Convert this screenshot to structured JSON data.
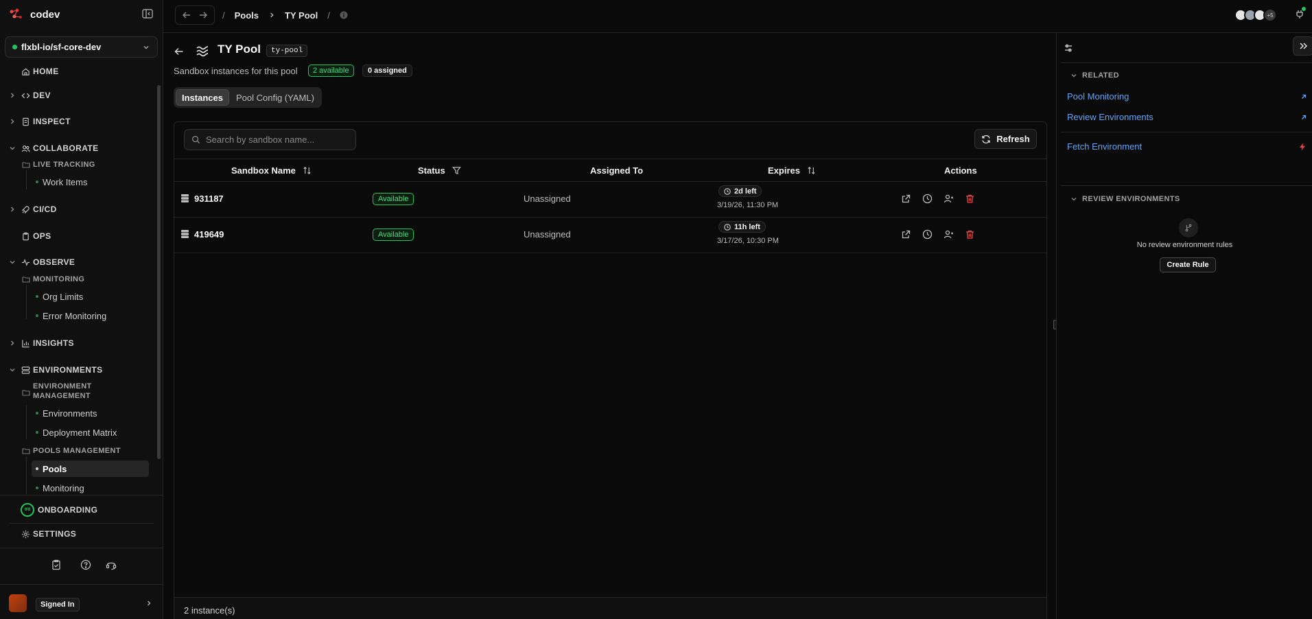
{
  "brand": {
    "name": "codev"
  },
  "workspace": {
    "name": "flxbl-io/sf-core-dev"
  },
  "sidebar": {
    "home": "HOME",
    "dev": "DEV",
    "inspect": "INSPECT",
    "collaborate": "COLLABORATE",
    "live_tracking": "LIVE TRACKING",
    "work_items": "Work Items",
    "cicd": "CI/CD",
    "ops": "OPS",
    "observe": "OBSERVE",
    "monitoring": "MONITORING",
    "org_limits": "Org Limits",
    "error_monitoring": "Error Monitoring",
    "insights": "INSIGHTS",
    "environments": "ENVIRONMENTS",
    "env_mgmt_1": "ENVIRONMENT",
    "env_mgmt_2": "MANAGEMENT",
    "environments_sub": "Environments",
    "deployment_matrix": "Deployment Matrix",
    "pools_mgmt": "POOLS MANAGEMENT",
    "pools": "Pools",
    "pools_monitoring": "Monitoring",
    "onboarding": "ONBOARDING",
    "onboarding_badge": "0/8",
    "settings": "SETTINGS"
  },
  "user": {
    "status": "Signed In"
  },
  "topbar": {
    "breadcrumbs": [
      "/",
      "Pools",
      "TY Pool",
      "/"
    ],
    "avatars_more": "+5"
  },
  "page": {
    "title": "TY Pool",
    "slug": "ty-pool",
    "subtitle": "Sandbox instances for this pool",
    "available_badge": "2 available",
    "assigned_badge": "0 assigned",
    "tabs": [
      {
        "label": "Instances",
        "active": true
      },
      {
        "label": "Pool Config (YAML)",
        "active": false
      }
    ]
  },
  "table": {
    "search_placeholder": "Search by sandbox name...",
    "refresh_label": "Refresh",
    "columns": [
      "Sandbox Name",
      "Status",
      "Assigned To",
      "Expires",
      "Actions"
    ],
    "rows": [
      {
        "name": "931187",
        "status": "Available",
        "assigned": "Unassigned",
        "time_left": "2d left",
        "expires": "3/19/26, 11:30 PM"
      },
      {
        "name": "419649",
        "status": "Available",
        "assigned": "Unassigned",
        "time_left": "11h left",
        "expires": "3/17/26, 10:30 PM"
      }
    ],
    "footer": "2 instance(s)"
  },
  "right_panel": {
    "related_title": "RELATED",
    "links": [
      "Pool Monitoring",
      "Review Environments",
      "Fetch Environment"
    ],
    "review_title": "REVIEW ENVIRONMENTS",
    "empty_text": "No review environment rules",
    "create_rule": "Create Rule"
  },
  "colors": {
    "accent_green": "#22c55e",
    "link_blue": "#60a5fa",
    "danger_red": "#ef4444"
  }
}
